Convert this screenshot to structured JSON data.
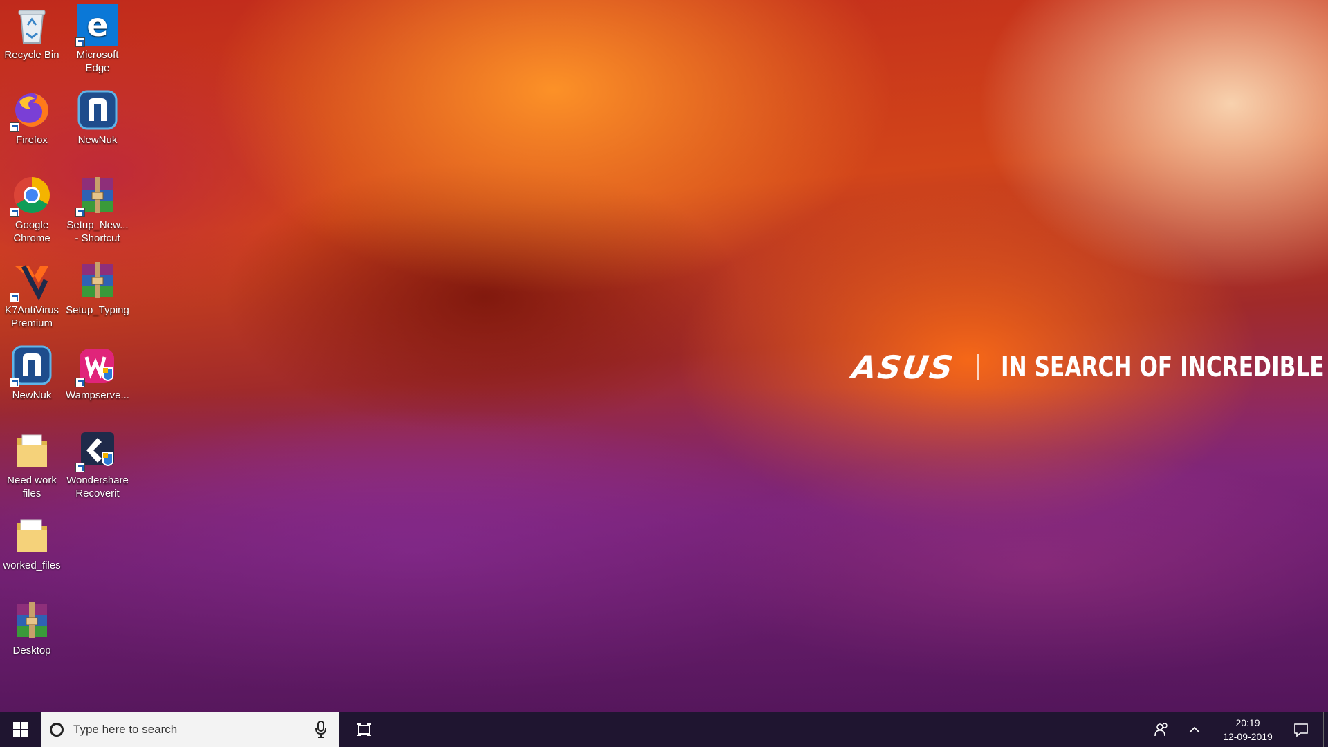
{
  "desktop": {
    "brand": {
      "logo": "ASUS",
      "tagline": "IN SEARCH OF INCREDIBLE"
    },
    "icons": [
      {
        "label": "Recycle Bin",
        "icon": "recycle-bin-icon"
      },
      {
        "label": "Microsoft Edge",
        "icon": "edge-icon"
      },
      {
        "label": "Firefox",
        "icon": "firefox-icon"
      },
      {
        "label": "NewNuk",
        "icon": "newnuk-icon"
      },
      {
        "label": "Google Chrome",
        "icon": "chrome-icon"
      },
      {
        "label": "Setup_New... - Shortcut",
        "icon": "winrar-archive-icon"
      },
      {
        "label": "K7AntiVirus Premium",
        "icon": "k7-antivirus-icon"
      },
      {
        "label": "Setup_Typing",
        "icon": "winrar-archive-icon"
      },
      {
        "label": "NewNuk",
        "icon": "newnuk-icon"
      },
      {
        "label": "Wampserve...",
        "icon": "wampserver-icon"
      },
      {
        "label": "Need work files",
        "icon": "folder-icon"
      },
      {
        "label": "Wondershare Recoverit",
        "icon": "recoverit-icon"
      },
      {
        "label": "worked_files",
        "icon": "folder-icon"
      },
      {
        "label": "Desktop",
        "icon": "winrar-archive-icon"
      }
    ]
  },
  "taskbar": {
    "search_placeholder": "Type here to search",
    "clock": {
      "time": "20:19",
      "date": "12-09-2019"
    }
  }
}
